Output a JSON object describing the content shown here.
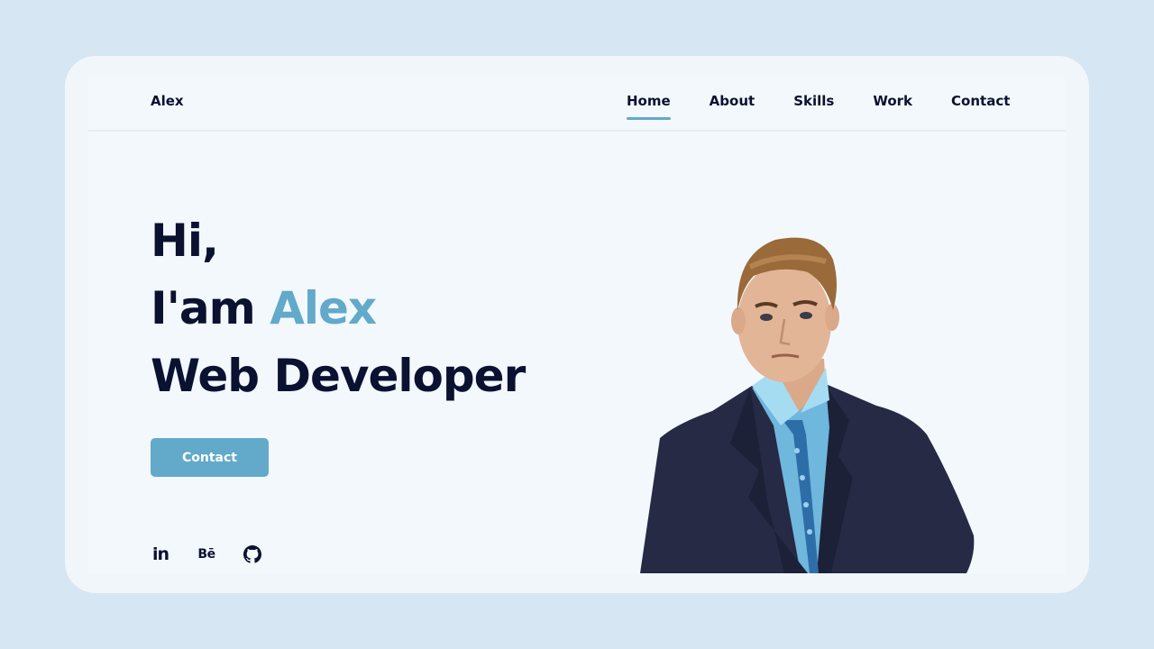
{
  "header": {
    "logo": "Alex",
    "nav": [
      {
        "label": "Home",
        "active": true
      },
      {
        "label": "About",
        "active": false
      },
      {
        "label": "Skills",
        "active": false
      },
      {
        "label": "Work",
        "active": false
      },
      {
        "label": "Contact",
        "active": false
      }
    ]
  },
  "hero": {
    "greeting": "Hi,",
    "intro_prefix": "I'am",
    "name": "Alex",
    "role": "Web Developer",
    "cta_label": "Contact"
  },
  "socials": [
    {
      "icon": "linkedin-icon",
      "glyph": "in"
    },
    {
      "icon": "behance-icon",
      "glyph": "Bē"
    },
    {
      "icon": "github-icon",
      "glyph": ""
    }
  ],
  "portrait": {
    "icon": "profile-photo"
  },
  "colors": {
    "background": "#d6e6f2",
    "card": "#f1f6fb",
    "text_dark": "#0b1130",
    "accent": "#62a9ca"
  }
}
